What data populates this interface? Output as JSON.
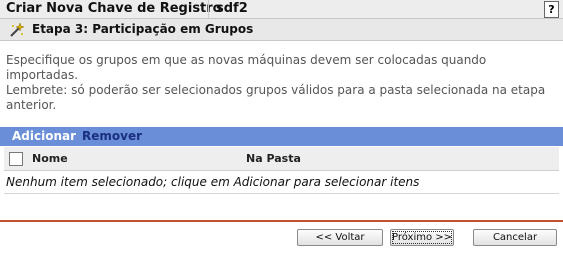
{
  "window": {
    "app_title": "Criar Nova Chave de Registro",
    "object_name": "sdf2",
    "help_label": "?"
  },
  "step": {
    "title": "Etapa 3: Participação em Grupos",
    "icon": "wand-icon"
  },
  "instructions": {
    "line1": "Especifique os grupos em que as novas máquinas devem ser colocadas quando importadas.",
    "line2": "Lembrete: só poderão ser selecionados grupos válidos para a pasta selecionada na etapa anterior."
  },
  "actions": {
    "add_label": "Adicionar",
    "remove_label": "Remover"
  },
  "table": {
    "columns": [
      "Nome",
      "Na Pasta"
    ],
    "empty_message": "Nenhum item selecionado; clique em Adicionar para selecionar itens"
  },
  "footer": {
    "back_label": "<< Voltar",
    "next_label": "Próximo >>",
    "cancel_label": "Cancelar"
  },
  "colors": {
    "action_bar": "#6a8fd8",
    "divider": "#c0522d"
  }
}
